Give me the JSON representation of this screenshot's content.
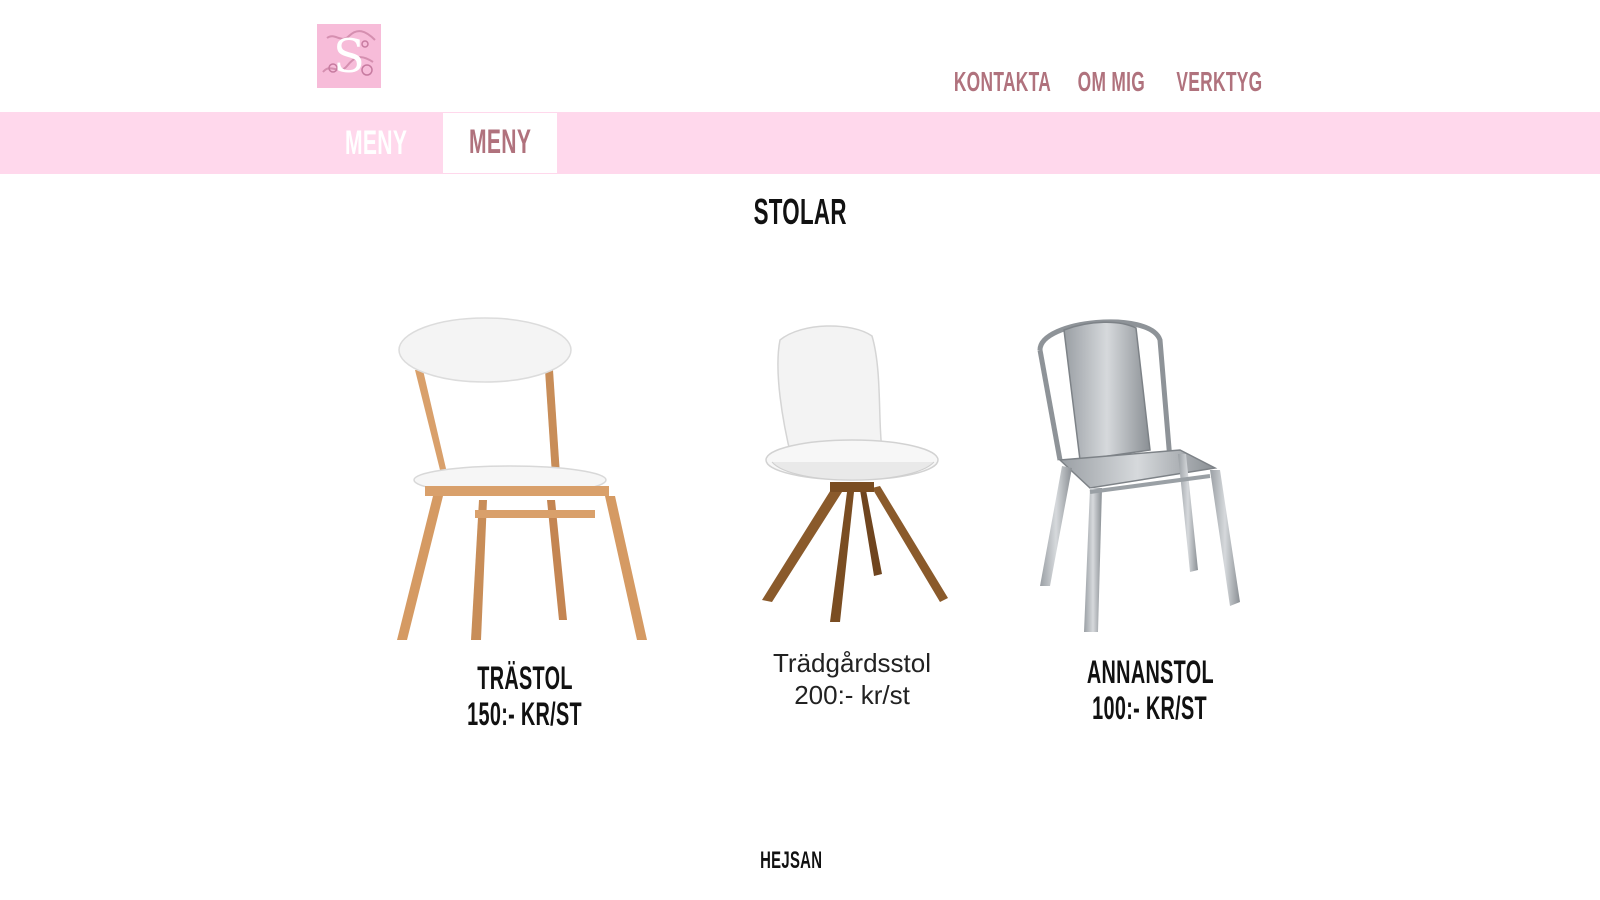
{
  "header": {
    "logo_letter": "S",
    "nav": [
      {
        "label": "KONTAKTA"
      },
      {
        "label": "OM MIG"
      },
      {
        "label": "VERKTYG"
      }
    ]
  },
  "menu": {
    "tabs": [
      {
        "label": "MENY",
        "active": false
      },
      {
        "label": "MENY",
        "active": true
      }
    ]
  },
  "main": {
    "title": "STOLAR",
    "products": [
      {
        "name": "TRÄSTOL",
        "price": "150:- KR/ST",
        "image": "wooden-chair-image"
      },
      {
        "name": "Trädgårdsstol",
        "price": "200:- kr/st",
        "image": "garden-chair-image"
      },
      {
        "name": "ANNANSTOL",
        "price": "100:- KR/ST",
        "image": "metal-chair-image"
      }
    ]
  },
  "footer": {
    "text": "HEJSAN"
  },
  "colors": {
    "accent_pink": "#ffd8ec",
    "logo_pink": "#f7bcd9",
    "nav_text": "#b0727d"
  }
}
